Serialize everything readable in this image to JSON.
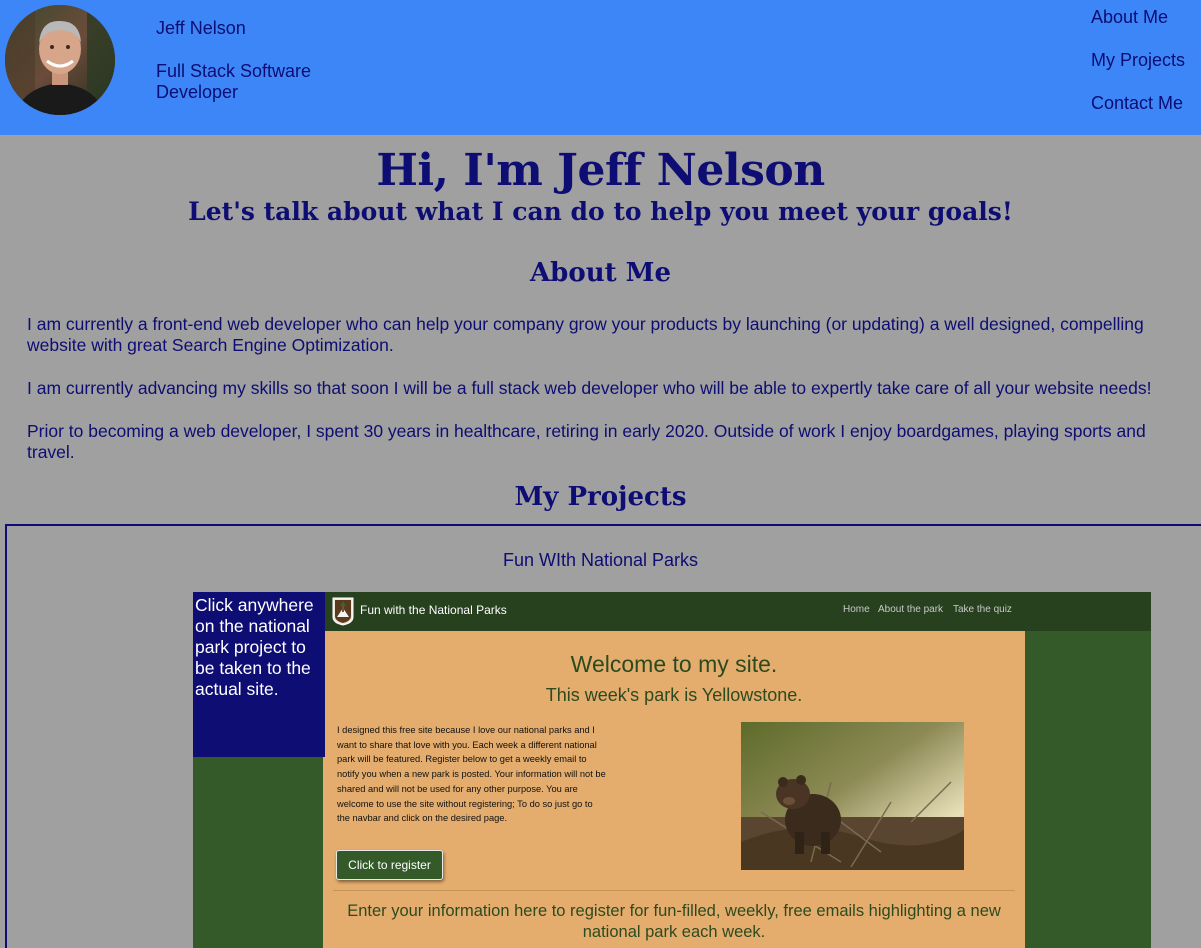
{
  "header": {
    "name": "Jeff Nelson",
    "title": "Full Stack Software Developer",
    "nav": [
      "About Me",
      "My Projects",
      "Contact Me"
    ]
  },
  "hero": {
    "title": "Hi, I'm Jeff Nelson",
    "subtitle": "Let's talk about what I can do to help you meet your goals!"
  },
  "about": {
    "heading": "About Me",
    "paragraphs": [
      "I am currently a front-end web developer who can help your company grow your products by launching (or updating) a well designed, compelling website with great Search Engine Optimization.",
      "I am currently advancing my skills so that soon I will be a full stack web developer who will be able to expertly take care of all your website needs!",
      "Prior to becoming a web developer, I spent 30 years in healthcare, retiring in early 2020. Outside of work I enjoy boardgames, playing sports and travel."
    ]
  },
  "projects": {
    "heading": "My Projects",
    "project_title": "Fun WIth National Parks",
    "click_note": "Click anywhere on the national park project to be taken to the actual site.",
    "preview": {
      "brand": "Fun with the National Parks",
      "nav": [
        "Home",
        "About the park",
        "Take the quiz"
      ],
      "welcome": "Welcome to my site.",
      "week": "This week's park is Yellowstone.",
      "intro": "I designed this free site because I love our national parks and I want to share that love with you. Each week a different national park will be featured. Register below to get a weekly email to notify you when a new park is posted. Your information will not be shared and will not be used for any other purpose. You are welcome to use the site without registering; To do so just go to the navbar and click on the desired page.",
      "register_button": "Click to register",
      "register_text": "Enter your information here to register for fun-filled, weekly, free emails highlighting a new national park each week."
    }
  },
  "colors": {
    "header_bg": "#3d86f7",
    "page_bg": "#a0a0a0",
    "text": "#0d0d73",
    "park_green": "#355a2a",
    "park_panel": "#e4ad6e"
  }
}
